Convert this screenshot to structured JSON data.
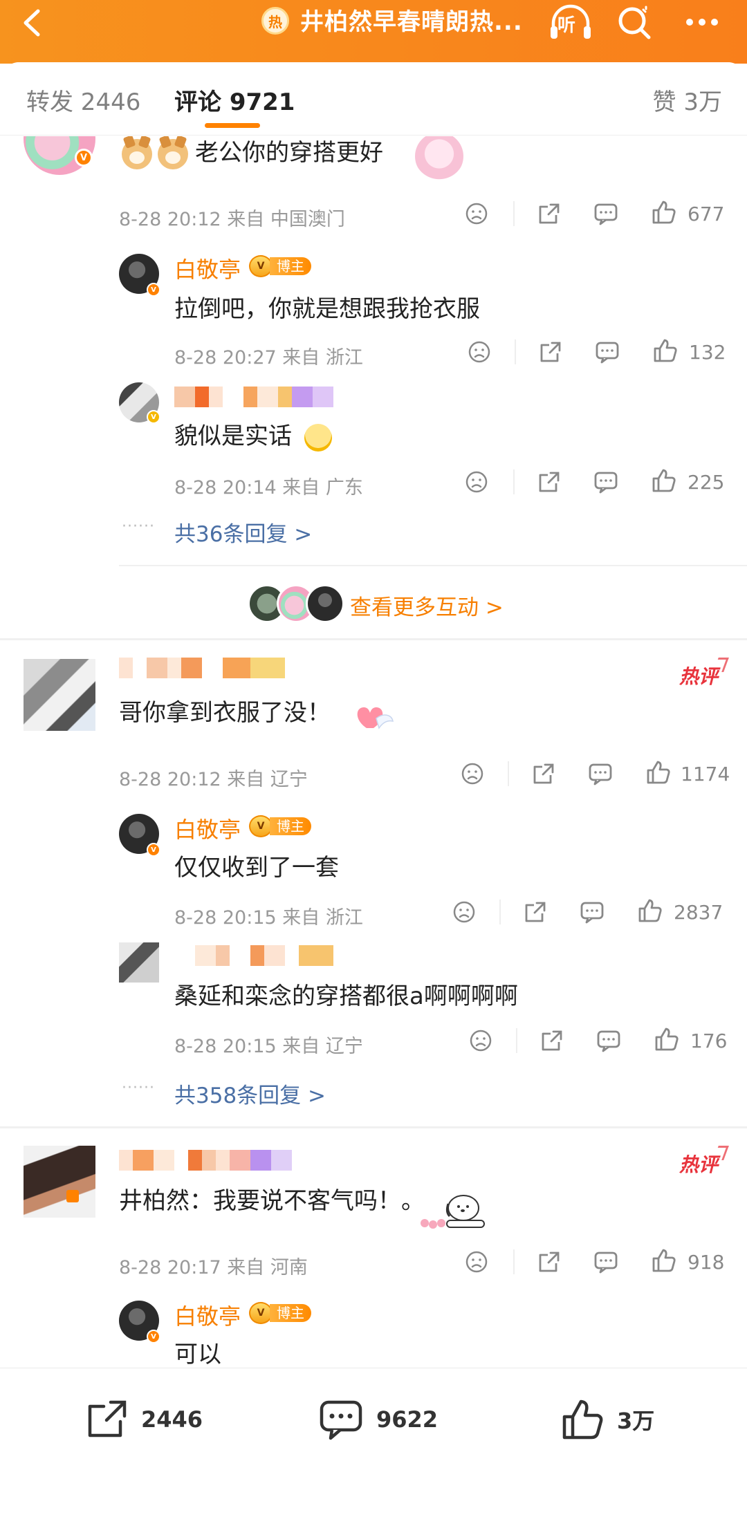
{
  "header": {
    "hot_badge": "热",
    "title": "井柏然早春晴朗热...",
    "listen_label": "听",
    "accent_color": "#f88a1c"
  },
  "tabs": {
    "repost": "转发 2446",
    "comments": "评论 9721",
    "likes": "赞 3万"
  },
  "comments": [
    {
      "text": "老公你的穿搭更好",
      "meta": "8-28 20:12 来自 中国澳门",
      "likes": "677",
      "replies": [
        {
          "author": "白敬亭",
          "tag": "博主",
          "text": "拉倒吧，你就是想跟我抢衣服",
          "meta": "8-28 20:27 来自 浙江",
          "likes": "132"
        },
        {
          "text": "貌似是实话",
          "meta": "8-28 20:14 来自 广东",
          "likes": "225"
        }
      ],
      "more_replies": "共36条回复 >",
      "more_interactions": "查看更多互动 >"
    },
    {
      "hot": "热评",
      "text": "哥你拿到衣服了没！",
      "meta": "8-28 20:12 来自 辽宁",
      "likes": "1174",
      "replies": [
        {
          "author": "白敬亭",
          "tag": "博主",
          "text": "仅仅收到了一套",
          "meta": "8-28 20:15 来自 浙江",
          "likes": "2837"
        },
        {
          "text": "桑延和栾念的穿搭都很a啊啊啊啊",
          "meta": "8-28 20:15 来自 辽宁",
          "likes": "176"
        }
      ],
      "more_replies": "共358条回复 >"
    },
    {
      "hot": "热评",
      "text": "井柏然：我要说不客气吗！。",
      "meta": "8-28 20:17 来自 河南",
      "likes": "918",
      "replies": [
        {
          "author": "白敬亭",
          "tag": "博主",
          "text": "可以"
        }
      ]
    }
  ],
  "bottom_bar": {
    "repost_count": "2446",
    "comment_count": "9622",
    "like_count": "3万"
  },
  "icons": [
    "back-icon",
    "hot-icon",
    "listen-icon",
    "search-icon",
    "more-icon",
    "dislike-icon",
    "share-icon",
    "reply-icon",
    "like-icon"
  ]
}
